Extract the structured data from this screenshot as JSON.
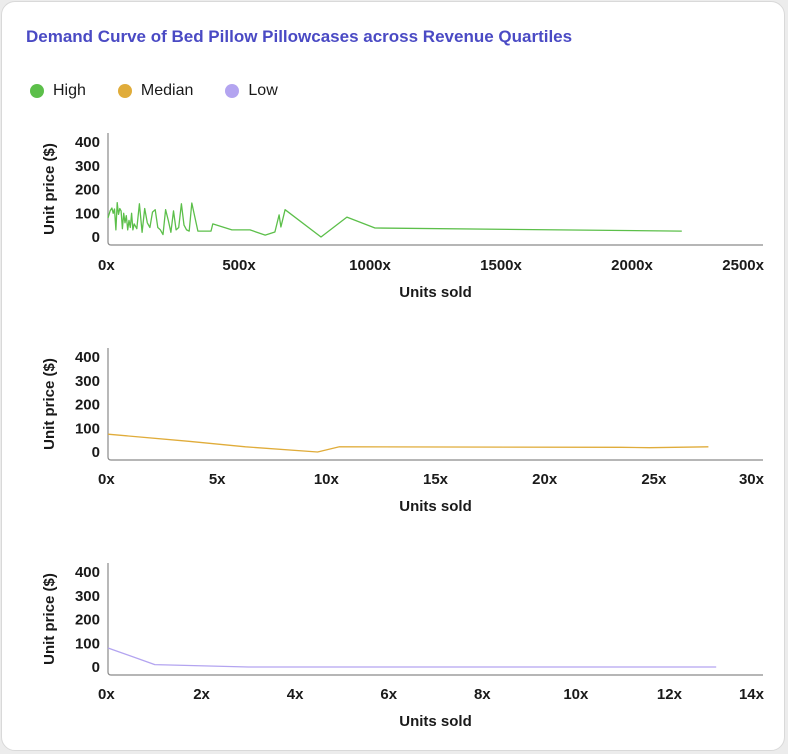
{
  "title": "Demand Curve of Bed Pillow Pillowcases across Revenue Quartiles",
  "legend": [
    {
      "label": "High",
      "color": "#5cbf4a"
    },
    {
      "label": "Median",
      "color": "#e0ac3a"
    },
    {
      "label": "Low",
      "color": "#b3a4f0"
    }
  ],
  "chart_data": [
    {
      "type": "line",
      "name": "High",
      "color": "#5cbf4a",
      "xlabel": "Units sold",
      "ylabel": "Unit price ($)",
      "xlim": [
        0,
        2500
      ],
      "ylim": [
        0,
        400
      ],
      "xticks": [
        "0x",
        "500x",
        "1000x",
        "1500x",
        "2000x",
        "2500x"
      ],
      "xtick_values": [
        0,
        500,
        1000,
        1500,
        2000,
        2500
      ],
      "yticks": [
        "0",
        "100",
        "200",
        "300",
        "400"
      ],
      "ytick_values": [
        0,
        100,
        200,
        300,
        400
      ],
      "x": [
        0,
        8,
        15,
        20,
        25,
        30,
        35,
        40,
        45,
        50,
        55,
        60,
        65,
        70,
        75,
        80,
        85,
        90,
        95,
        100,
        110,
        120,
        130,
        140,
        150,
        160,
        170,
        180,
        190,
        200,
        210,
        220,
        230,
        240,
        250,
        260,
        270,
        280,
        290,
        300,
        310,
        320,
        343,
        393,
        400,
        473,
        542,
        600,
        637,
        653,
        660,
        676,
        813,
        912,
        1019,
        2190
      ],
      "y": [
        80,
        110,
        122,
        100,
        118,
        30,
        145,
        95,
        120,
        110,
        35,
        100,
        60,
        90,
        30,
        70,
        40,
        100,
        30,
        55,
        35,
        140,
        20,
        120,
        60,
        40,
        105,
        115,
        40,
        30,
        10,
        115,
        70,
        20,
        110,
        30,
        40,
        140,
        50,
        30,
        25,
        143,
        25,
        25,
        55,
        30,
        30,
        8,
        21,
        93,
        42,
        115,
        0,
        84,
        38,
        25
      ]
    },
    {
      "type": "line",
      "name": "Median",
      "color": "#e0ac3a",
      "xlabel": "Units sold",
      "ylabel": "Unit price ($)",
      "xlim": [
        0,
        30
      ],
      "ylim": [
        0,
        400
      ],
      "xticks": [
        "0x",
        "5x",
        "10x",
        "15x",
        "20x",
        "25x",
        "30x"
      ],
      "xtick_values": [
        0,
        5,
        10,
        15,
        20,
        25,
        30
      ],
      "yticks": [
        "0",
        "100",
        "200",
        "300",
        "400"
      ],
      "ytick_values": [
        0,
        100,
        200,
        300,
        400
      ],
      "x": [
        0,
        3.7,
        6.3,
        9.6,
        10.6,
        23.5,
        24.8,
        27.5
      ],
      "y": [
        75,
        45,
        22,
        0,
        22,
        20,
        18,
        22
      ]
    },
    {
      "type": "line",
      "name": "Low",
      "color": "#b3a4f0",
      "xlabel": "Units sold",
      "ylabel": "Unit price ($)",
      "xlim": [
        0,
        14
      ],
      "ylim": [
        0,
        400
      ],
      "xticks": [
        "0x",
        "2x",
        "4x",
        "6x",
        "8x",
        "10x",
        "12x",
        "14x"
      ],
      "xtick_values": [
        0,
        2,
        4,
        6,
        8,
        10,
        12,
        14
      ],
      "yticks": [
        "0",
        "100",
        "200",
        "300",
        "400"
      ],
      "ytick_values": [
        0,
        100,
        200,
        300,
        400
      ],
      "x": [
        0,
        1,
        3,
        13
      ],
      "y": [
        80,
        10,
        0,
        0
      ]
    }
  ]
}
